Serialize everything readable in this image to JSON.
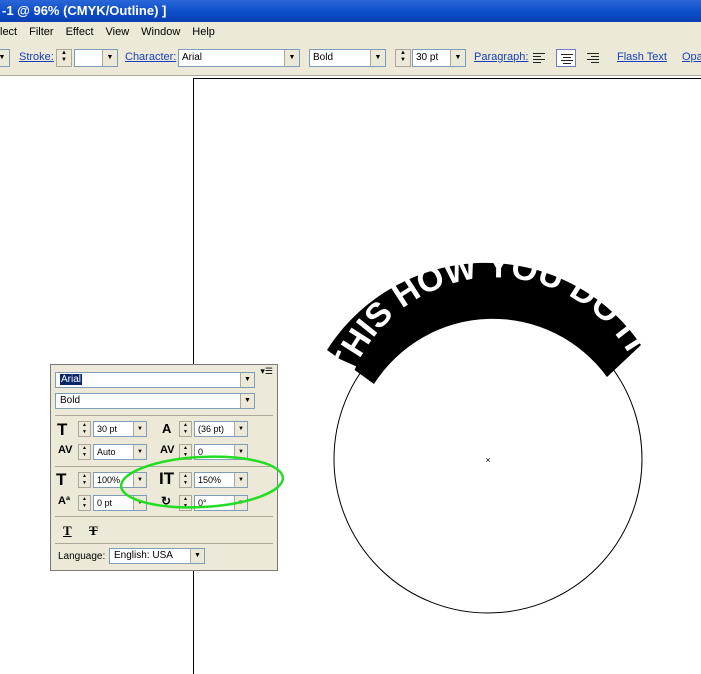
{
  "window": {
    "title": "-1 @ 96% (CMYK/Outline) ]"
  },
  "menu": [
    "lect",
    "Filter",
    "Effect",
    "View",
    "Window",
    "Help"
  ],
  "control_bar": {
    "stroke_label": "Stroke:",
    "character_label": "Character:",
    "font_family": "Arial",
    "font_style": "Bold",
    "font_size": "30 pt",
    "paragraph_label": "Paragraph:",
    "flash_text_label": "Flash Text",
    "opacity_label": "Opa"
  },
  "artwork": {
    "arc_text": "THIS HOW YOU DO IT",
    "center_mark": "×"
  },
  "character_panel": {
    "font_family": "Arial",
    "font_style": "Bold",
    "font_size": "30 pt",
    "leading": "(36 pt)",
    "kerning": "Auto",
    "tracking": "0",
    "horizontal_scale": "100%",
    "vertical_scale": "150%",
    "baseline_shift": "0 pt",
    "character_rotation": "0°",
    "language_label": "Language:",
    "language": "English: USA",
    "menu_glyph": "▾☰"
  },
  "colors": {
    "highlight_ellipse": "#22dd22",
    "title_bar": "#0b4bc7",
    "chrome": "#ece9d8"
  }
}
